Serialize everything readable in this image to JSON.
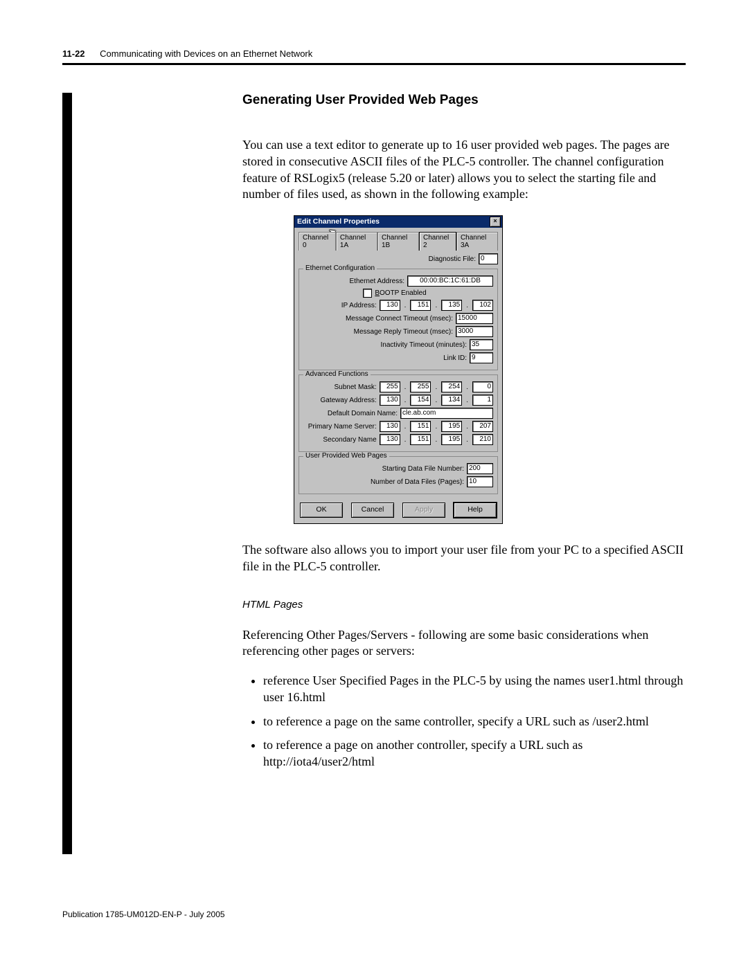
{
  "header": {
    "page_number": "11-22",
    "running_title": "Communicating with Devices on an Ethernet Network"
  },
  "section": {
    "heading": "Generating User Provided Web Pages",
    "para1": "You can use a text editor to generate up to 16 user provided web pages. The pages are stored in consecutive ASCII files of the PLC-5 controller. The channel configuration feature of RSLogix5 (release 5.20 or later) allows you to select the starting file and number of files used, as shown in the following example:",
    "para2": "The software also allows you to import your user file from your PC to a specified ASCII file in the PLC-5 controller.",
    "subhead": "HTML Pages",
    "para3": "Referencing Other Pages/Servers - following are some basic considerations when referencing other pages or servers:",
    "bullets": [
      "reference User Specified Pages in the PLC-5 by using the names user1.html through user 16.html",
      "to reference a page on the same controller, specify a URL such as /user2.html",
      "to reference a page on another controller, specify a URL such as http://iota4/user2/html"
    ]
  },
  "dialog": {
    "title": "Edit Channel Properties",
    "tabs": [
      "Channel 0",
      "Channel 1A",
      "Channel 1B",
      "Channel 2",
      "Channel 3A"
    ],
    "active_tab_index": 3,
    "diagnostic_file_label": "Diagnostic File:",
    "diagnostic_file_value": "0",
    "groups": {
      "ethernet": {
        "legend": "Ethernet Configuration",
        "ethernet_address_label": "Ethernet Address:",
        "ethernet_address_value": "00:00:BC:1C:61:DB",
        "bootp_label": "BOOTP Enabled",
        "bootp_prefix": "B",
        "bootp_rest": "OOTP Enabled",
        "ip_label": "IP Address:",
        "ip": [
          "130",
          "151",
          "135",
          "102"
        ],
        "msg_connect_label": "Message Connect Timeout (msec):",
        "msg_connect_value": "15000",
        "msg_reply_label": "Message Reply Timeout (msec):",
        "msg_reply_value": "3000",
        "inactivity_label": "Inactivity Timeout (minutes):",
        "inactivity_value": "35",
        "linkid_label": "Link ID:",
        "linkid_value": "9"
      },
      "advanced": {
        "legend": "Advanced Functions",
        "subnet_label": "Subnet Mask:",
        "subnet": [
          "255",
          "255",
          "254",
          "0"
        ],
        "gateway_label": "Gateway Address:",
        "gateway": [
          "130",
          "154",
          "134",
          "1"
        ],
        "domain_label": "Default Domain Name:",
        "domain_value": "cle.ab.com",
        "pns_label": "Primary Name Server:",
        "pns": [
          "130",
          "151",
          "195",
          "207"
        ],
        "sns_label": "Secondary Name",
        "sns": [
          "130",
          "151",
          "195",
          "210"
        ]
      },
      "userweb": {
        "legend": "User Provided Web Pages",
        "start_label": "Starting Data File Number:",
        "start_value": "200",
        "count_label": "Number of Data Files (Pages):",
        "count_value": "10"
      }
    },
    "buttons": {
      "ok": "OK",
      "cancel": "Cancel",
      "apply": "Apply",
      "help": "Help"
    }
  },
  "footer": "Publication 1785-UM012D-EN-P - July 2005"
}
